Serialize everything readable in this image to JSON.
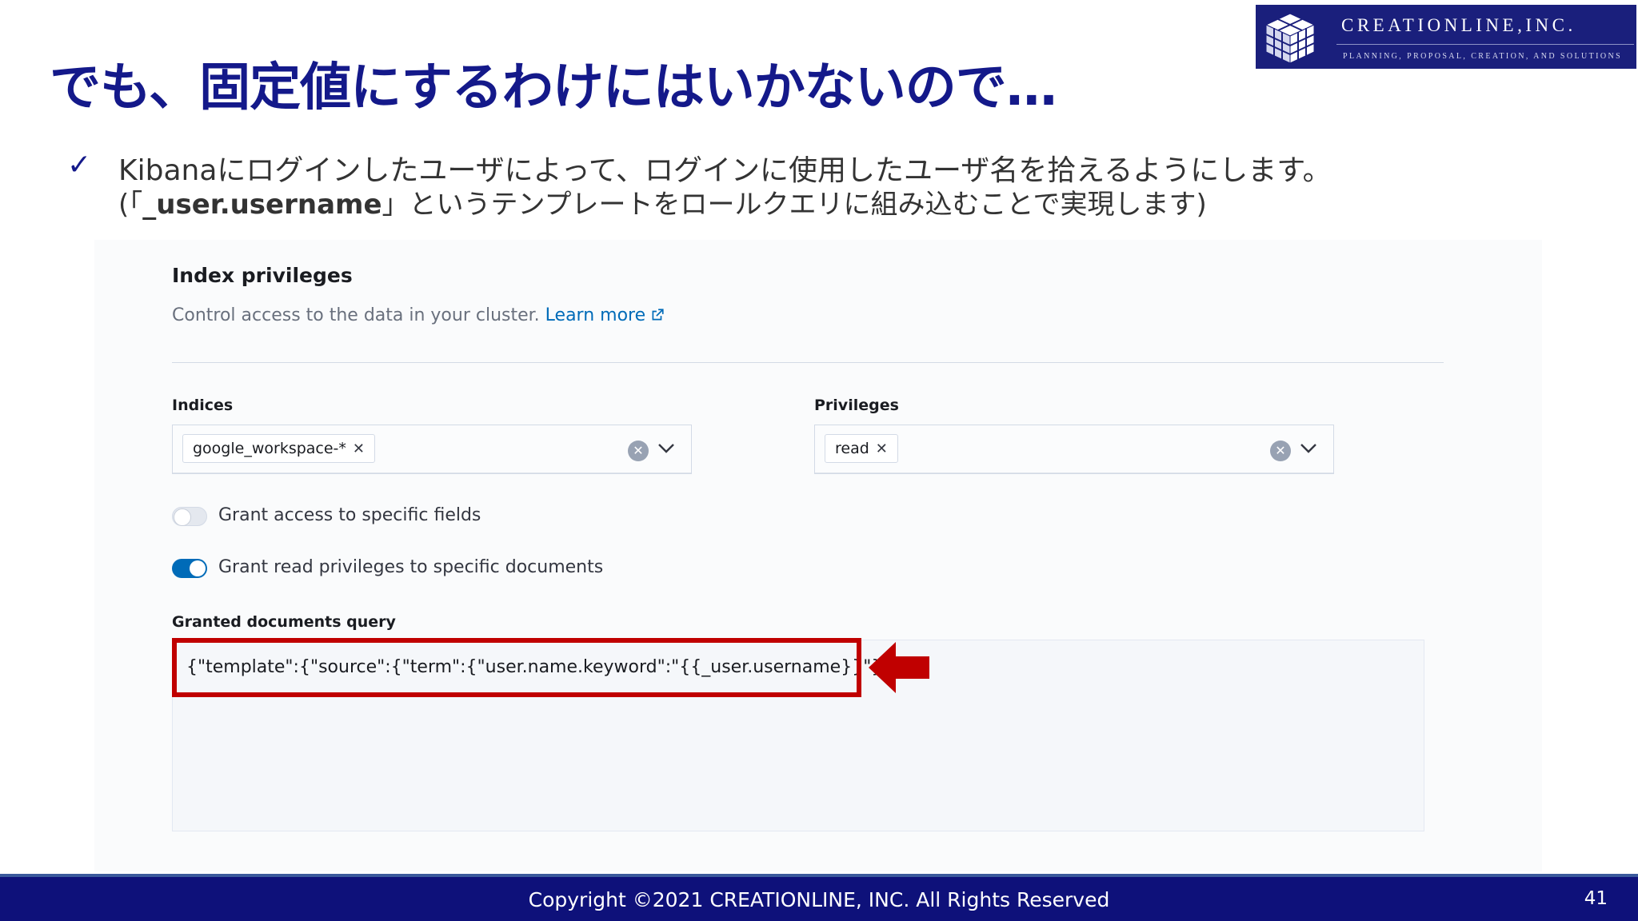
{
  "slide": {
    "title": "でも、固定値にするわけにはいかないので…",
    "bullet_mark": "✓",
    "line1": "Kibanaにログインしたユーザによって、ログインに使用したユーザ名を拾えるようにします。",
    "line2_prefix": "(「",
    "line2_bold": "_user.username",
    "line2_suffix": "」というテンプレートをロールクエリに組み込むことで実現します)"
  },
  "logo": {
    "company": "CREATIONLINE,INC.",
    "tagline": "PLANNING, PROPOSAL, CREATION, AND SOLUTIONS"
  },
  "index_privileges": {
    "title": "Index privileges",
    "description": "Control access to the data in your cluster.",
    "learn_more": "Learn more",
    "indices": {
      "label": "Indices",
      "selected": "google_workspace-*"
    },
    "privileges": {
      "label": "Privileges",
      "selected": "read"
    },
    "toggle_fields": {
      "label": "Grant access to specific fields",
      "on": false
    },
    "toggle_documents": {
      "label": "Grant read privileges to specific documents",
      "on": true
    },
    "query": {
      "label": "Granted documents query",
      "value": "{\"template\":{\"source\":{\"term\":{\"user.name.keyword\":\"{{_user.username}}\"}}}}"
    }
  },
  "footer": {
    "copyright": "Copyright ©2021 CREATIONLINE, INC. All Rights Reserved",
    "page": "41"
  },
  "colors": {
    "title_navy": "#14198a",
    "accent_blue": "#006bb8",
    "highlight_red": "#c00000",
    "toggle_on": "#006bb8",
    "toggle_off": "#d3dae6"
  },
  "icons": {
    "check": "check-icon",
    "external_link": "external-link-icon",
    "clear": "clear-icon",
    "chevron": "chevron-down-icon",
    "remove": "close-icon",
    "arrow": "arrow-left-icon"
  }
}
